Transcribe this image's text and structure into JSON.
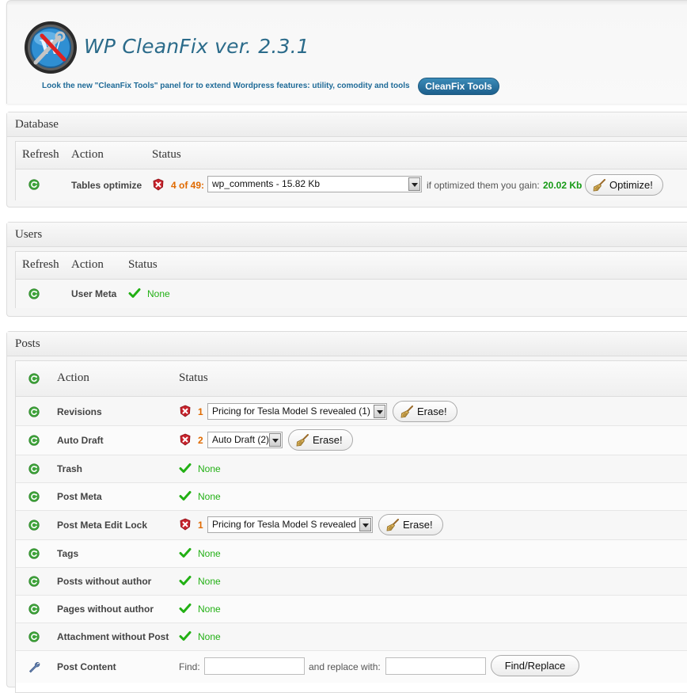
{
  "header": {
    "title": "WP CleanFix ver. 2.3.1",
    "tagline": "Look the new \"CleanFix Tools\" panel for to extend Wordpress features: utility, comodity and tools",
    "tools_button": "CleanFix Tools"
  },
  "database": {
    "title": "Database",
    "columns": {
      "refresh": "Refresh",
      "action": "Action",
      "status": "Status"
    },
    "row": {
      "label": "Tables optimize",
      "count": "4 of 49:",
      "selected_table": "wp_comments - 15.82 Kb",
      "gain_text": "if optimized them you gain:",
      "gain_value": "20.02 Kb",
      "button": "Optimize!"
    }
  },
  "users": {
    "title": "Users",
    "columns": {
      "refresh": "Refresh",
      "action": "Action",
      "status": "Status"
    },
    "row": {
      "label": "User Meta",
      "status": "None"
    }
  },
  "posts": {
    "title": "Posts",
    "columns": {
      "action": "Action",
      "status": "Status"
    },
    "rows": [
      {
        "label": "Revisions",
        "count": "1",
        "select": "Pricing for Tesla Model S revealed (1)",
        "button": "Erase!"
      },
      {
        "label": "Auto Draft",
        "count": "2",
        "select": "Auto Draft (2)",
        "button": "Erase!"
      },
      {
        "label": "Trash",
        "status": "None"
      },
      {
        "label": "Post Meta",
        "status": "None"
      },
      {
        "label": "Post Meta Edit Lock",
        "count": "1",
        "select": "Pricing for Tesla Model S revealed",
        "button": "Erase!"
      },
      {
        "label": "Tags",
        "status": "None"
      },
      {
        "label": "Posts without author",
        "status": "None"
      },
      {
        "label": "Pages without author",
        "status": "None"
      },
      {
        "label": "Attachment without Post",
        "status": "None"
      },
      {
        "label": "Post Content",
        "find_label": "Find:",
        "replace_label": "and replace with:",
        "button": "Find/Replace"
      }
    ]
  },
  "colors": {
    "accent": "#1e6a97",
    "ok": "#22b014",
    "warning": "#e06a00",
    "gain": "#169a16",
    "error": "#c8232c"
  }
}
